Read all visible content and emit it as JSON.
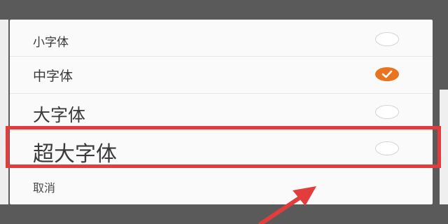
{
  "dialog": {
    "options": [
      {
        "label": "小字体",
        "selected": false
      },
      {
        "label": "中字体",
        "selected": true
      },
      {
        "label": "大字体",
        "selected": false
      },
      {
        "label": "超大字体",
        "selected": false
      }
    ],
    "cancel_label": "取消"
  },
  "colors": {
    "accent": "#e9731f",
    "highlight": "#e23c3c",
    "backdrop": "#5a5a5a",
    "sheet": "#fafafa"
  },
  "icons": {
    "check": "checkmark-icon",
    "arrow": "arrow-pointer-icon"
  }
}
